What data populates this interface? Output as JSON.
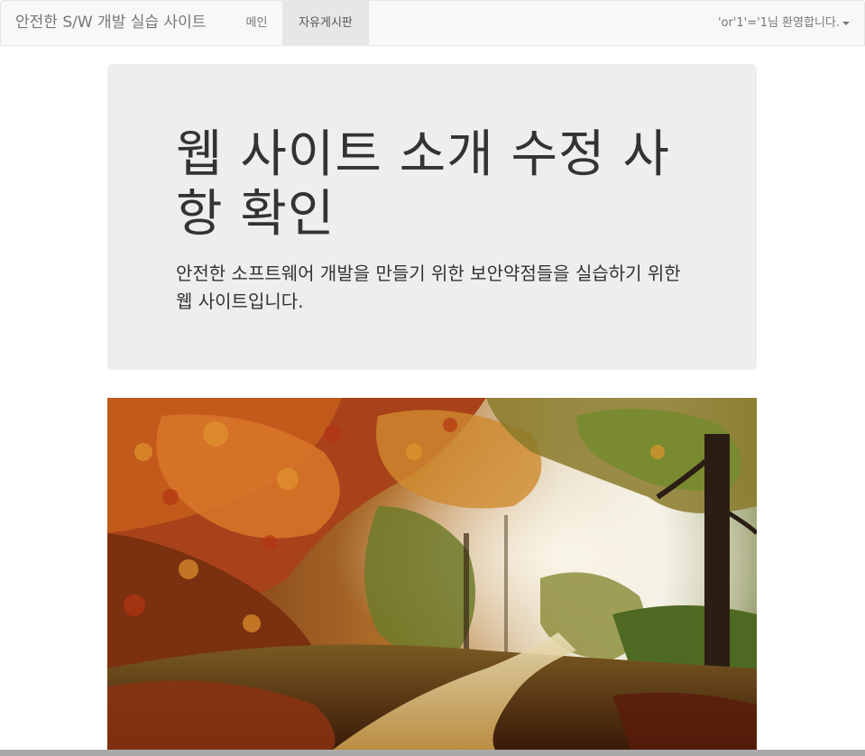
{
  "navbar": {
    "brand": "안전한 S/W 개발 실습 사이트",
    "items": [
      {
        "label": "메인"
      },
      {
        "label": "자유게시판",
        "active": true
      }
    ],
    "user_menu": "'or'1'='1님 환영합니다."
  },
  "jumbotron": {
    "title": "웹 사이트 소개 수정 사항 확인",
    "description": "안전한 소프트웨어 개발을 만들기 위한 보안약점들을 실습하기 위한 웹 사이트입니다."
  },
  "image": {
    "subject": "autumn forest path"
  },
  "colors": {
    "navbar_bg": "#f8f8f8",
    "active_tab_bg": "#e7e7e7",
    "jumbotron_bg": "#eeeeee"
  }
}
